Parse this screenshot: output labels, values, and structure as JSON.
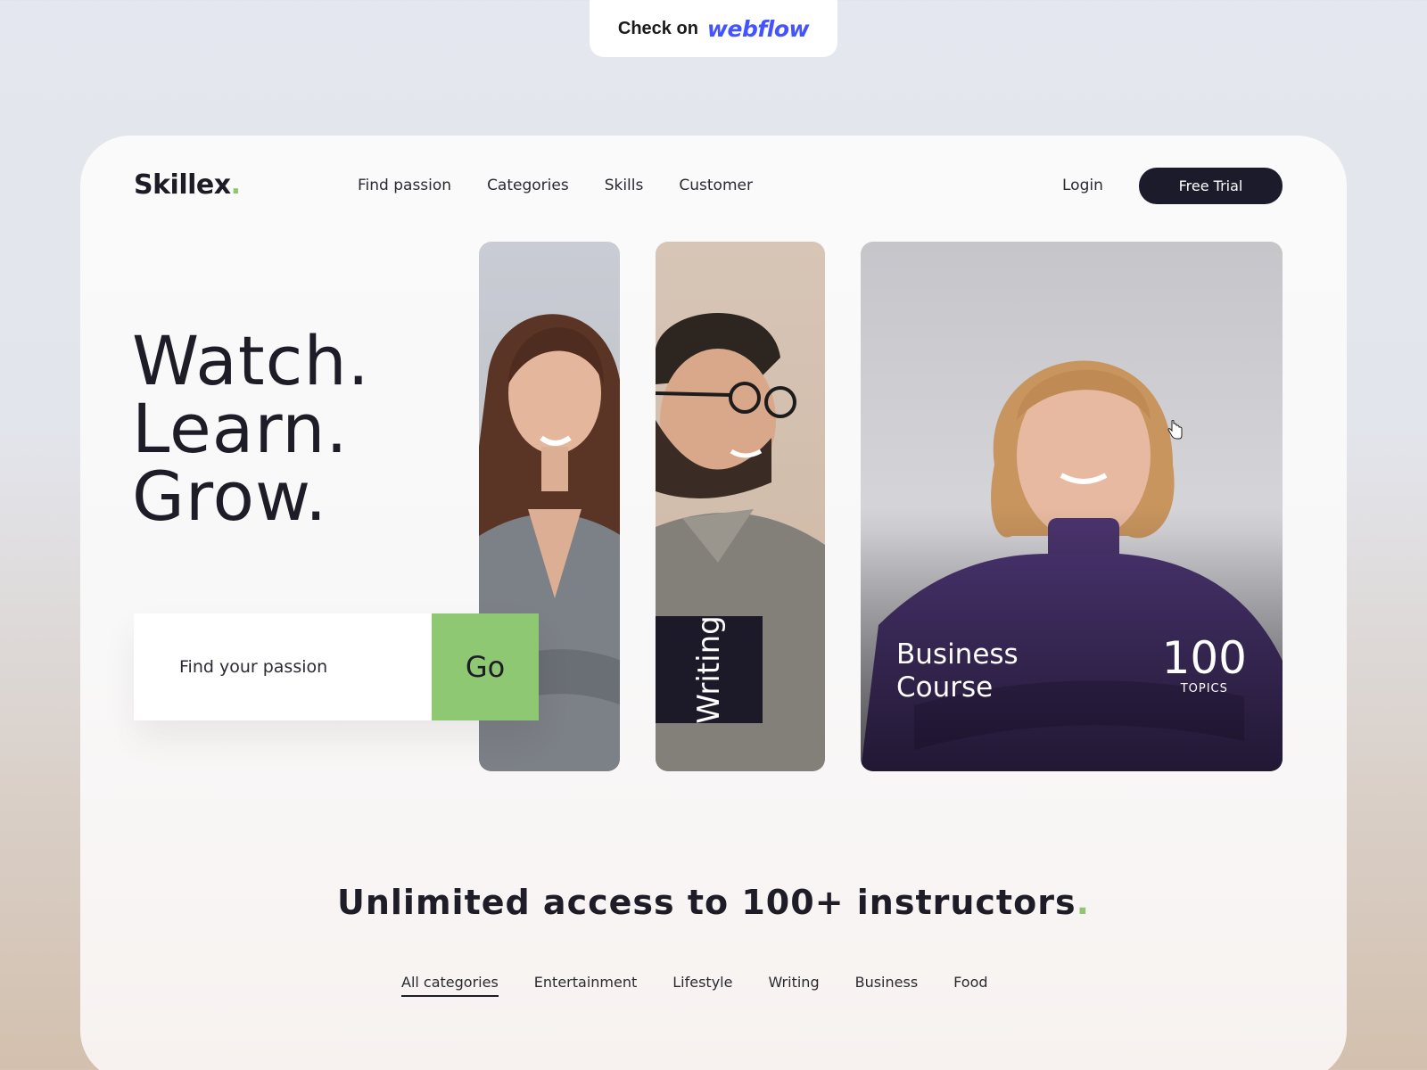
{
  "badge": {
    "prefix": "Check on",
    "brand": "webflow"
  },
  "header": {
    "logo": "Skillex",
    "logo_dot": ".",
    "nav": [
      "Find passion",
      "Categories",
      "Skills",
      "Customer"
    ],
    "login": "Login",
    "cta": "Free Trial"
  },
  "hero": {
    "lines": [
      "Watch.",
      "Learn.",
      "Grow."
    ],
    "search": {
      "placeholder": "Find your passion",
      "button": "Go"
    }
  },
  "cards": {
    "writing": {
      "label": "Writing"
    },
    "business": {
      "title_line1": "Business",
      "title_line2": "Course",
      "count": "100",
      "unit": "TOPICS"
    }
  },
  "section": {
    "title": "Unlimited access to 100+ instructors",
    "dot": ".",
    "categories": [
      "All categories",
      "Entertainment",
      "Lifestyle",
      "Writing",
      "Business",
      "Food"
    ],
    "active_category": "All categories"
  },
  "colors": {
    "accent": "#8fc872",
    "dark": "#1b1b2b",
    "webflow": "#4353ff"
  }
}
